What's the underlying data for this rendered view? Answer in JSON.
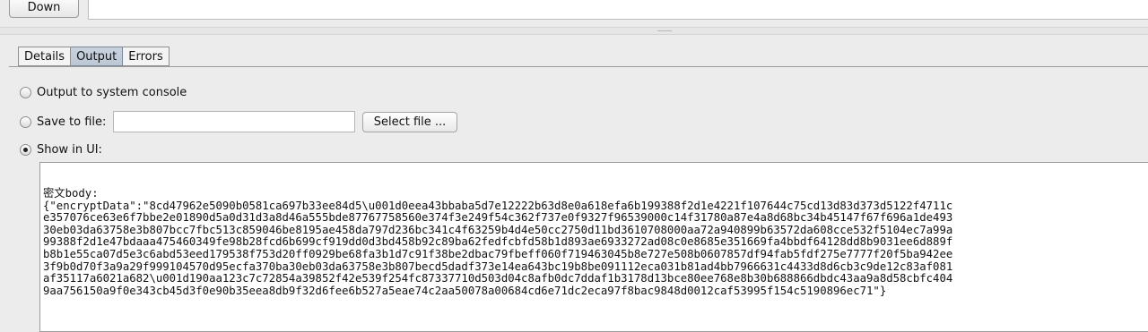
{
  "top": {
    "down_label": "Down"
  },
  "tabs": [
    {
      "label": "Details"
    },
    {
      "label": "Output"
    },
    {
      "label": "Errors"
    }
  ],
  "options": {
    "system_console_label": "Output to system console",
    "save_to_file_label": "Save to file:",
    "file_path_value": "",
    "select_file_label": "Select file ...",
    "show_in_ui_label": "Show in UI:",
    "selected": "show_in_ui"
  },
  "output": {
    "lines": [
      "密文body:",
      "{\"encryptData\":\"8cd47962e5090b0581ca697b33ee84d5\\u001d0eea43bbaba5d7e12222b63d8e0a618efa6b199388f2d1e4221f107644c75cd13d83d373d5122f4711c",
      "e357076ce63e6f7bbe2e01890d5a0d31d3a8d46a555bde87767758560e374f3e249f54c362f737e0f9327f96539000c14f31780a87e4a8d68bc34b45147f67f696a1de493",
      "30eb03da63758e3b807bcc7fbc513c859046be8195ae458da797d236bc341c4f63259b4d4e50cc2750d11bd3610708000aa72a940899b63572da608cce532f5104ec7a99a",
      "99388f2d1e47bdaaa475460349fe98b28fcd6b699cf919dd0d3bd458b92c89ba62fedfcbfd58b1d893ae6933272ad08c0e8685e351669fa4bbdf64128dd8b9031ee6d889f",
      "b8b1e55ca07d5e3c6abd53eed179538f753d20ff0929be68fa3b1d7c91f38be2dbac79fbeff060f719463045b8e727e508b0607857df94fab5fdf275e7777f20f5ba942ee",
      "3f9b0d70f3a9a29f999104570d95ecfa370ba30eb03da63758e3b807becd5dadf373e14ea643bc19b8be091112eca031b81ad4bb7966631c4433d8d6cb3c9de12c83af081",
      "af35117a6021a682\\u001d190aa123c7c72854a39852f42e539f254fc87337710d503d04c8afb0dc7ddaf1b3178d13bce80ee768e8b30b688866dbdc43aa9a8d58cbfc404",
      "9aa756150a9f0e343cb45d3f0e90b35eea8db9f32d6fee6b527a5eae74c2aa50078a00684cd6e71dc2eca97f8bac9848d0012caf53995f154c5190896ec71\"}"
    ]
  }
}
